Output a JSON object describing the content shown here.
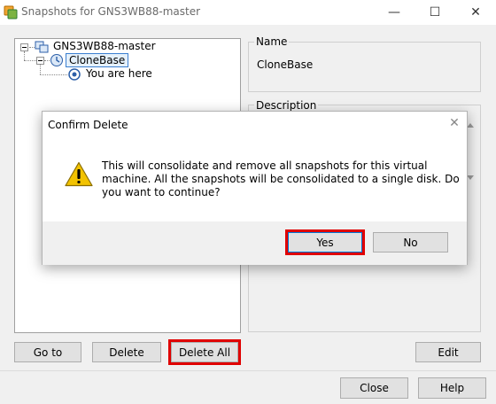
{
  "window": {
    "title": "Snapshots for GNS3WB88-master",
    "minimize_glyph": "—",
    "maximize_glyph": "☐",
    "close_glyph": "✕"
  },
  "tree": {
    "root_label": "GNS3WB88-master",
    "child_label": "CloneBase",
    "current_label": "You are here"
  },
  "details": {
    "name_legend": "Name",
    "name_value": "CloneBase",
    "description_legend": "Description"
  },
  "buttons": {
    "goto": "Go to",
    "delete": "Delete",
    "delete_all": "Delete All",
    "edit": "Edit",
    "close": "Close",
    "help": "Help"
  },
  "dialog": {
    "title": "Confirm Delete",
    "close_glyph": "✕",
    "message": "This will consolidate and remove all snapshots for this virtual machine. All the snapshots will be consolidated to a single disk. Do you want to continue?",
    "yes": "Yes",
    "no": "No"
  },
  "icons": {
    "app": "vmware-icon",
    "warning": "warning-icon",
    "vm": "vm-icon",
    "snapshot": "snapshot-icon",
    "you_are_here": "current-state-icon"
  },
  "colors": {
    "highlight": "#e00000",
    "selection_border": "#3b7fd1",
    "warning": "#f2c200"
  }
}
